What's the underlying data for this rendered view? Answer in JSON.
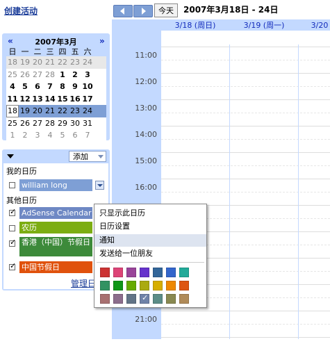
{
  "create_event": "创建活动",
  "minical": {
    "prev": "«",
    "next": "»",
    "month": "2007年3月",
    "weekdays": [
      "日",
      "一",
      "二",
      "三",
      "四",
      "五",
      "六"
    ],
    "weeks": [
      [
        "18",
        "19",
        "20",
        "21",
        "22",
        "23",
        "24"
      ],
      [
        "25",
        "26",
        "27",
        "28",
        "1",
        "2",
        "3"
      ],
      [
        "4",
        "5",
        "6",
        "7",
        "8",
        "9",
        "10"
      ],
      [
        "11",
        "12",
        "13",
        "14",
        "15",
        "16",
        "17"
      ],
      [
        "18",
        "19",
        "20",
        "21",
        "22",
        "23",
        "24"
      ],
      [
        "25",
        "26",
        "27",
        "28",
        "29",
        "30",
        "31"
      ],
      [
        "1",
        "2",
        "3",
        "4",
        "5",
        "6",
        "7"
      ]
    ]
  },
  "calendars": {
    "add_label": "添加",
    "my_label": "我的日历",
    "other_label": "其他日历",
    "my": [
      {
        "name": "william long",
        "color": "#7e9fd5",
        "checked": false
      }
    ],
    "other": [
      {
        "name": "AdSense Calendar",
        "color": "#6e88c4",
        "checked": true
      },
      {
        "name": "农历",
        "color": "#7cad12",
        "checked": false
      },
      {
        "name": "香港（中国）节假日",
        "color": "#3d8a3a",
        "checked": true
      },
      {
        "name": "中国节假日",
        "color": "#e0520d",
        "checked": true
      }
    ],
    "manage_label": "管理日"
  },
  "header": {
    "today": "今天",
    "date_range": "2007年3月18日 - 24日"
  },
  "days": [
    "3/18 (周日)",
    "3/19 (周一)",
    "3/20"
  ],
  "times": [
    "11:00",
    "12:00",
    "13:00",
    "14:00",
    "15:00",
    "16:00",
    "21:00"
  ],
  "menu": {
    "items": [
      "只显示此日历",
      "日历设置",
      "通知",
      "发送给一位朋友"
    ],
    "highlighted_item": "通知",
    "swatches": [
      [
        "#cc3333",
        "#dd4477",
        "#994499",
        "#6633cc",
        "#336699",
        "#3366cc",
        "#22aa99"
      ],
      [
        "#329262",
        "#109618",
        "#66aa00",
        "#aaaa11",
        "#d6ae00",
        "#ee8800",
        "#dd5511"
      ],
      [
        "#a87070",
        "#8c6d8c",
        "#627487",
        "#7083a8",
        "#5c8d87",
        "#898951",
        "#b08b59"
      ]
    ],
    "selected_swatch": "#7083a8"
  }
}
